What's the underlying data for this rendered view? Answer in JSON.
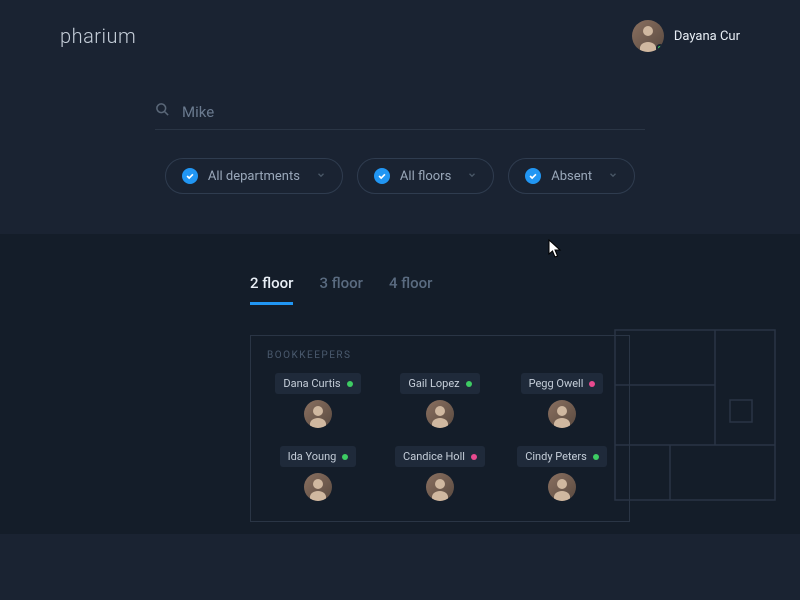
{
  "brand": "pharium",
  "current_user": {
    "name": "Dayana Cur",
    "status": "online"
  },
  "search": {
    "value": "Mike",
    "placeholder": "Search"
  },
  "filters": [
    {
      "label": "All departments"
    },
    {
      "label": "All floors"
    },
    {
      "label": "Absent"
    }
  ],
  "floor_tabs": [
    {
      "label": "2 floor",
      "active": true
    },
    {
      "label": "3 floor",
      "active": false
    },
    {
      "label": "4 floor",
      "active": false
    }
  ],
  "room": {
    "name": "BOOKKEEPERS",
    "people": [
      {
        "name": "Dana Curtis",
        "status": "green"
      },
      {
        "name": "Gail Lopez",
        "status": "green"
      },
      {
        "name": "Pegg Owell",
        "status": "pink"
      },
      {
        "name": "Ida Young",
        "status": "green"
      },
      {
        "name": "Candice Holl",
        "status": "pink"
      },
      {
        "name": "Cindy Peters",
        "status": "green"
      }
    ]
  },
  "colors": {
    "accent": "#2196f3",
    "online": "#3dcc63",
    "absent": "#e84a8f"
  }
}
